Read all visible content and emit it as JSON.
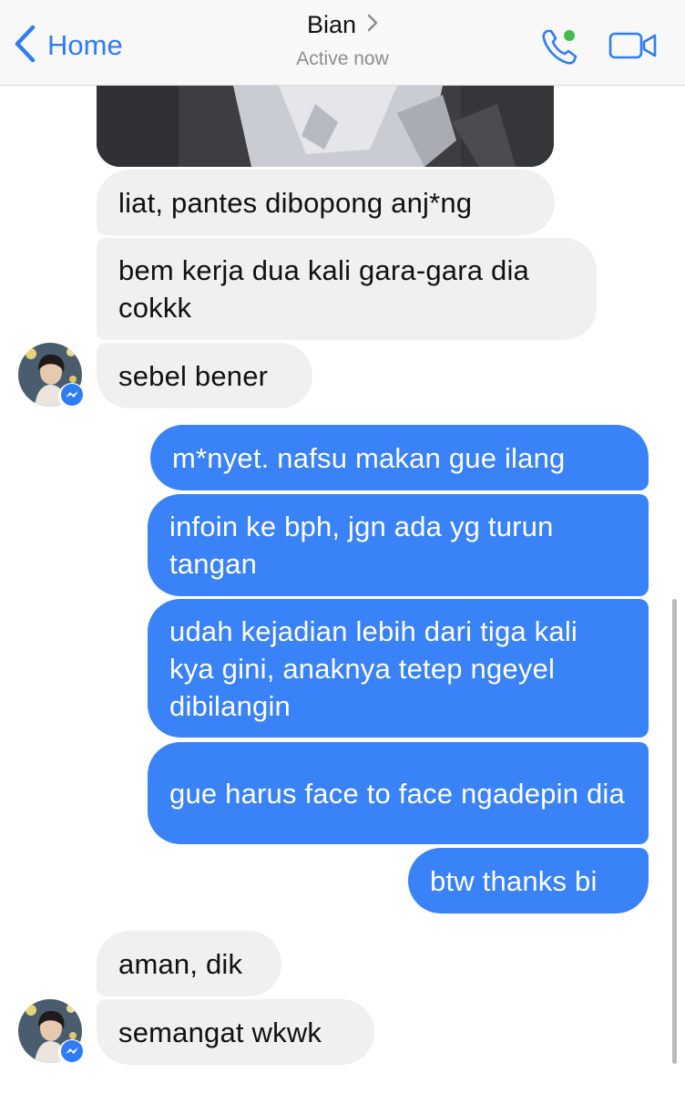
{
  "header": {
    "back_label": "Home",
    "contact_name": "Bian",
    "status": "Active now"
  },
  "colors": {
    "accent": "#2e7cf6",
    "outgoing_bubble": "#3a82f7",
    "incoming_bubble": "#f0f0f0",
    "online_dot": "#44bb4f"
  },
  "messages": [
    {
      "direction": "in",
      "text": "liat, pantes dibopong anj*ng"
    },
    {
      "direction": "in",
      "text": "bem kerja dua kali gara-gara dia cokkk"
    },
    {
      "direction": "in",
      "text": "sebel bener"
    },
    {
      "direction": "out",
      "text": "m*nyet. nafsu makan gue ilang"
    },
    {
      "direction": "out",
      "text": "infoin ke bph, jgn ada yg turun tangan"
    },
    {
      "direction": "out",
      "text": "udah kejadian lebih dari tiga kali kya gini, anaknya tetep ngeyel dibilangin"
    },
    {
      "direction": "out",
      "text": "gue harus face to face ngadepin dia"
    },
    {
      "direction": "out",
      "text": "btw thanks bi"
    },
    {
      "direction": "in",
      "text": "aman, dik"
    },
    {
      "direction": "in",
      "text": "semangat wkwk"
    }
  ]
}
